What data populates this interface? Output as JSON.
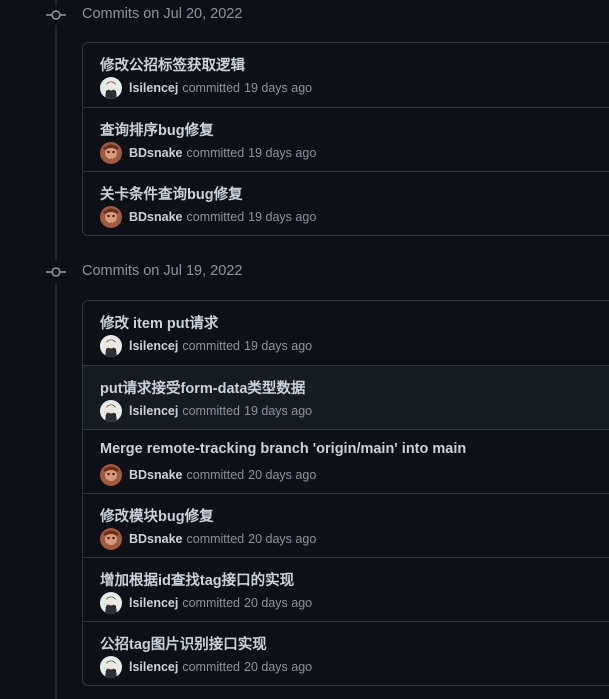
{
  "groups": [
    {
      "header": "Commits on Jul 20, 2022",
      "commits": [
        {
          "title": "修改公招标签获取逻辑",
          "author": "lsilencej",
          "verb": "committed",
          "time": "19 days ago",
          "avatar": "avatar-lsilencej"
        },
        {
          "title": "查询排序bug修复",
          "author": "BDsnake",
          "verb": "committed",
          "time": "19 days ago",
          "avatar": "avatar-bdsnake"
        },
        {
          "title": "关卡条件查询bug修复",
          "author": "BDsnake",
          "verb": "committed",
          "time": "19 days ago",
          "avatar": "avatar-bdsnake"
        }
      ]
    },
    {
      "header": "Commits on Jul 19, 2022",
      "commits": [
        {
          "title": "修改 item put请求",
          "author": "lsilencej",
          "verb": "committed",
          "time": "19 days ago",
          "avatar": "avatar-lsilencej"
        },
        {
          "title": "put请求接受form-data类型数据",
          "author": "lsilencej",
          "verb": "committed",
          "time": "19 days ago",
          "avatar": "avatar-lsilencej"
        },
        {
          "title": "Merge remote-tracking branch 'origin/main' into main",
          "author": "BDsnake",
          "verb": "committed",
          "time": "20 days ago",
          "avatar": "avatar-bdsnake"
        },
        {
          "title": "修改模块bug修复",
          "author": "BDsnake",
          "verb": "committed",
          "time": "20 days ago",
          "avatar": "avatar-bdsnake"
        },
        {
          "title": "增加根据id查找tag接口的实现",
          "author": "lsilencej",
          "verb": "committed",
          "time": "20 days ago",
          "avatar": "avatar-lsilencej"
        },
        {
          "title": "公招tag图片识别接口实现",
          "author": "lsilencej",
          "verb": "committed",
          "time": "20 days ago",
          "avatar": "avatar-lsilencej"
        }
      ]
    }
  ],
  "colors": {
    "background": "#0d1117",
    "border": "#30363d",
    "muted_text": "#8b949e",
    "primary_text": "#c9d1d9",
    "hover_row": "#161b22"
  }
}
